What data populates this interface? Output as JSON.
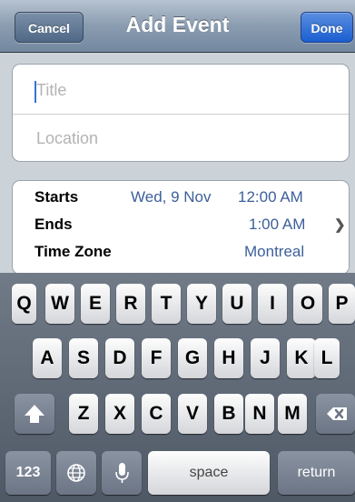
{
  "navbar": {
    "title": "Add Event",
    "cancel_label": "Cancel",
    "done_label": "Done"
  },
  "form": {
    "title_placeholder": "Title",
    "location_placeholder": "Location",
    "starts_label": "Starts",
    "starts_date": "Wed, 9 Nov",
    "starts_time": "12:00 AM",
    "ends_label": "Ends",
    "ends_time": "1:00 AM",
    "timezone_label": "Time Zone",
    "timezone_value": "Montreal"
  },
  "keyboard": {
    "row1": [
      "Q",
      "W",
      "E",
      "R",
      "T",
      "Y",
      "U",
      "I",
      "O",
      "P"
    ],
    "row2": [
      "A",
      "S",
      "D",
      "F",
      "G",
      "H",
      "J",
      "K",
      "L"
    ],
    "row3": [
      "Z",
      "X",
      "C",
      "V",
      "B",
      "N",
      "M"
    ],
    "numbers_label": "123",
    "space_label": "space",
    "return_label": "return",
    "icons": [
      "shift-icon",
      "backspace-icon",
      "globe-icon",
      "microphone-icon"
    ]
  },
  "colors": {
    "accent": "#1a5ed0",
    "value_text": "#3d5f9a",
    "nav_bar": "#8a9cb0"
  }
}
